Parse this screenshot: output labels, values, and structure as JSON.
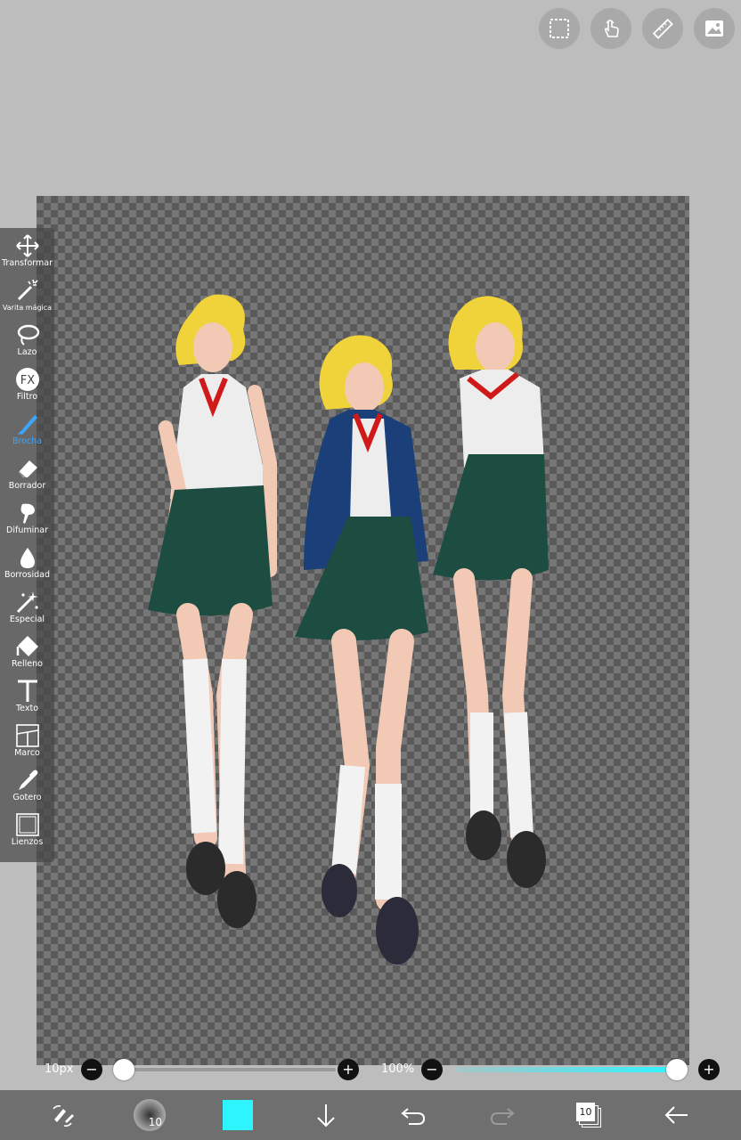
{
  "top_actions": [
    {
      "name": "selection-icon"
    },
    {
      "name": "touch-hand-icon"
    },
    {
      "name": "ruler-icon"
    },
    {
      "name": "image-icon"
    }
  ],
  "tools": [
    {
      "label": "Transformar",
      "icon": "move-arrows-icon"
    },
    {
      "label": "Varita mágica",
      "icon": "magic-wand-icon"
    },
    {
      "label": "Lazo",
      "icon": "lasso-icon"
    },
    {
      "label": "Filtro",
      "icon": "fx-icon"
    },
    {
      "label": "Brocha",
      "icon": "brush-icon",
      "active": true
    },
    {
      "label": "Borrador",
      "icon": "eraser-icon"
    },
    {
      "label": "Difuminar",
      "icon": "smudge-icon"
    },
    {
      "label": "Borrosidad",
      "icon": "blur-drop-icon"
    },
    {
      "label": "Especial",
      "icon": "sparkle-icon"
    },
    {
      "label": "Relleno",
      "icon": "fill-bucket-icon"
    },
    {
      "label": "Texto",
      "icon": "text-icon"
    },
    {
      "label": "Marco",
      "icon": "frame-icon"
    },
    {
      "label": "Gotero",
      "icon": "eyedropper-icon"
    },
    {
      "label": "Lienzos",
      "icon": "canvas-icon"
    }
  ],
  "brush_size": {
    "label": "10px",
    "value_fraction": 0.0
  },
  "opacity": {
    "label": "100%",
    "value_fraction": 1.0
  },
  "bottom": {
    "brush_preview_label": "10",
    "color": "#2ef4ff",
    "layers_count": "10"
  },
  "colors": {
    "background": "#bdbdbd",
    "toolbar": "#4a4a4a",
    "active_tool": "#3aa6ff",
    "bottom_bar": "#6f6f6f"
  }
}
